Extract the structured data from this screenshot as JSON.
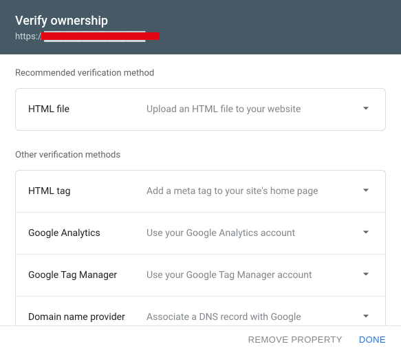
{
  "header": {
    "title": "Verify ownership",
    "url": "https://████████████████/"
  },
  "sections": {
    "recommended_label": "Recommended verification method",
    "other_label": "Other verification methods"
  },
  "methods": {
    "recommended": {
      "name": "HTML file",
      "desc": "Upload an HTML file to your website"
    },
    "other": [
      {
        "name": "HTML tag",
        "desc": "Add a meta tag to your site's home page"
      },
      {
        "name": "Google Analytics",
        "desc": "Use your Google Analytics account"
      },
      {
        "name": "Google Tag Manager",
        "desc": "Use your Google Tag Manager account"
      },
      {
        "name": "Domain name provider",
        "desc": "Associate a DNS record with Google"
      }
    ]
  },
  "footer": {
    "remove": "REMOVE PROPERTY",
    "done": "DONE"
  }
}
